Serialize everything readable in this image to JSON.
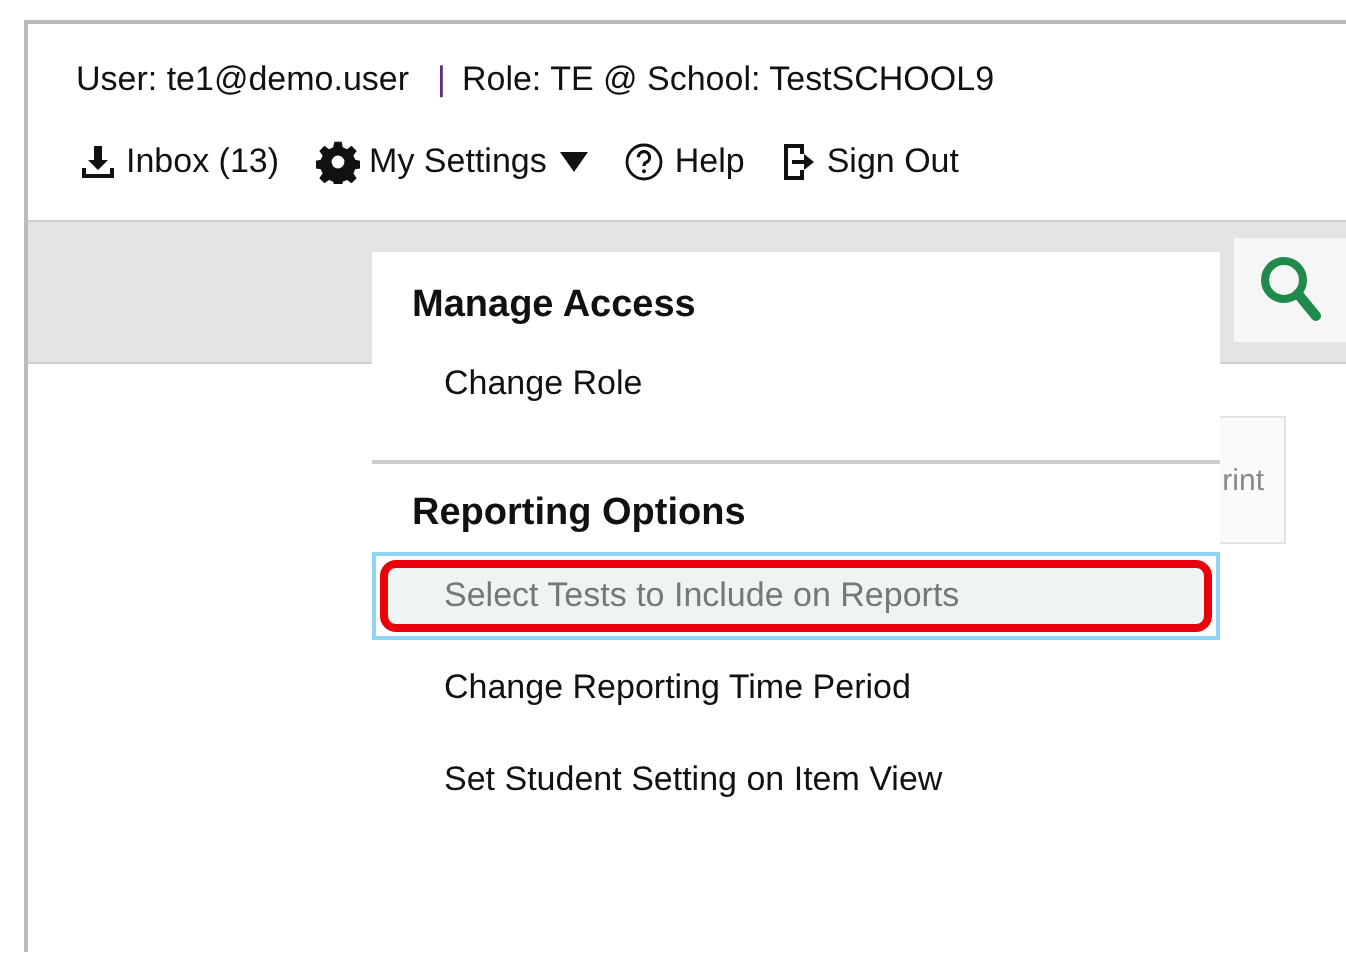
{
  "header": {
    "user": "User: te1@demo.user",
    "separator": "|",
    "role": "Role: TE @ School: TestSCHOOL9"
  },
  "nav": [
    {
      "kind": "inbox",
      "label": "Inbox (13)"
    },
    {
      "kind": "settings",
      "label": "My Settings",
      "expanded": true
    },
    {
      "kind": "help",
      "label": "Help"
    },
    {
      "kind": "signout",
      "label": "Sign Out"
    }
  ],
  "toolbar": {
    "print_label": "rint"
  },
  "settings_menu": [
    {
      "kind": "heading",
      "label": "Manage Access"
    },
    {
      "kind": "item",
      "label": "Change Role",
      "selected": false
    },
    {
      "kind": "divider"
    },
    {
      "kind": "heading",
      "label": "Reporting Options"
    },
    {
      "kind": "item",
      "label": "Select Tests to Include on Reports",
      "selected": true
    },
    {
      "kind": "item",
      "label": "Change Reporting Time Period",
      "selected": false
    },
    {
      "kind": "item",
      "label": "Set Student Setting on Item View",
      "selected": false
    }
  ]
}
